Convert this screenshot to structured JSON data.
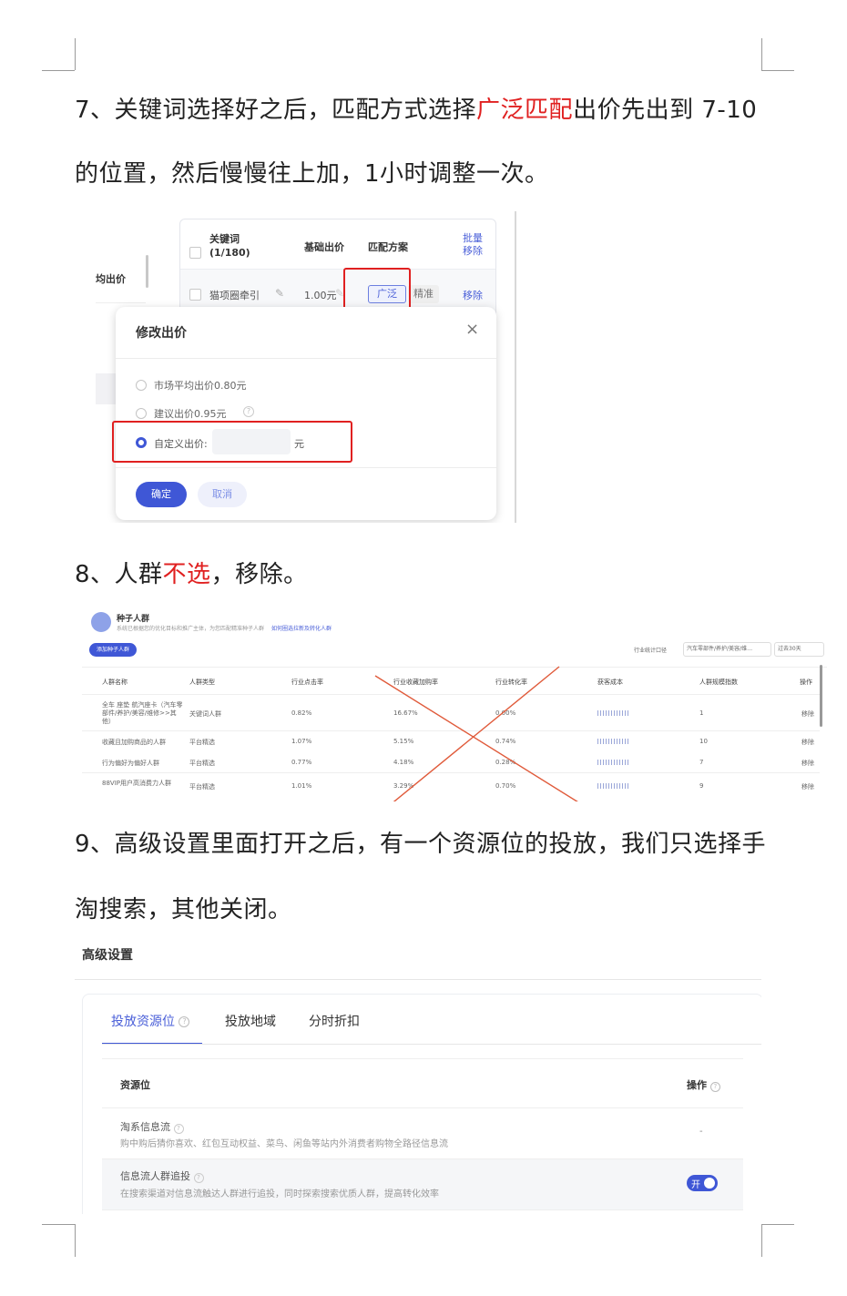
{
  "doc": {
    "p7_line1_a": "7、关键词选择好之后，匹配方式选择",
    "p7_line1_red": "广泛匹配",
    "p7_line1_b": "出价先出到 7-10",
    "p7_line2": "的位置，然后慢慢往上加，1小时调整一次。",
    "p8_a": "8、人群",
    "p8_red": "不选",
    "p8_b": "，移除。",
    "p9_line1": "9、高级设置里面打开之后，有一个资源位的投放，我们只选择手",
    "p9_line2": "淘搜索，其他关闭。"
  },
  "shot1": {
    "left_label": "均出价",
    "col_keyword": "关键词",
    "col_keyword_count": "(1/180)",
    "col_bid": "基础出价",
    "col_match": "匹配方案",
    "batch_remove_1": "批量",
    "batch_remove_2": "移除",
    "row_keyword": "猫项圈牵引",
    "row_bid": "1.00元",
    "match_broad": "广泛",
    "match_exact": "精准",
    "row_remove": "移除",
    "dialog_title": "修改出价",
    "close_symbol": "×",
    "opt_market": "市场平均出价0.80元",
    "opt_suggest": "建议出价0.95元",
    "opt_custom": "自定义出价:",
    "unit": "元",
    "btn_ok": "确定",
    "btn_cancel": "取消"
  },
  "shot2": {
    "title": "种子人群",
    "subtitle": "系统已根据您的优化目标和推广主体，为您匹配精准种子人群",
    "subtitle_link": "如何圈选拉新及转化人群",
    "add_button": "添加种子人群",
    "filter_label": "行业统计口径",
    "filter_value": "汽车零部件/养护/美容/维…",
    "filter_days": "过去30天",
    "headers": [
      "人群名称",
      "人群类型",
      "行业点击率",
      "行业收藏加购率",
      "行业转化率",
      "获客成本",
      "人群规模指数",
      "操作"
    ],
    "rows": [
      {
        "name": "全车 座垫 航汽座卡（汽车零部件/养护/美容/维修>>其他）",
        "type": "关键词人群",
        "ctr": "0.82%",
        "fav": "16.67%",
        "cvr": "0.00%",
        "size": "1",
        "op": "移除"
      },
      {
        "name": "收藏且加购商品的人群",
        "type": "平台精选",
        "ctr": "1.07%",
        "fav": "5.15%",
        "cvr": "0.74%",
        "size": "10",
        "op": "移除"
      },
      {
        "name": "行为偏好为偏好人群",
        "type": "平台精选",
        "ctr": "0.77%",
        "fav": "4.18%",
        "cvr": "0.28%",
        "size": "7",
        "op": "移除"
      },
      {
        "name": "88VIP用户高消费力人群",
        "type": "平台精选",
        "ctr": "1.01%",
        "fav": "3.29%",
        "cvr": "0.70%",
        "size": "9",
        "op": "移除"
      }
    ]
  },
  "shot3": {
    "section_title": "高级设置",
    "tab_placement": "投放资源位",
    "tab_region": "投放地域",
    "tab_time": "分时折扣",
    "col_resource": "资源位",
    "col_action": "操作",
    "row1_title": "淘系信息流",
    "row1_desc": "购中购后猜你喜欢、红包互动权益、菜鸟、闲鱼等站内外消费者购物全路径信息流",
    "row1_action": "-",
    "row2_title": "信息流人群追投",
    "row2_desc": "在搜索渠道对信息流触达人群进行追投，同时探索搜索优质人群，提高转化效率",
    "toggle_label": "开"
  },
  "colors": {
    "accent": "#4a5fd8",
    "highlight_red": "#e02020"
  }
}
